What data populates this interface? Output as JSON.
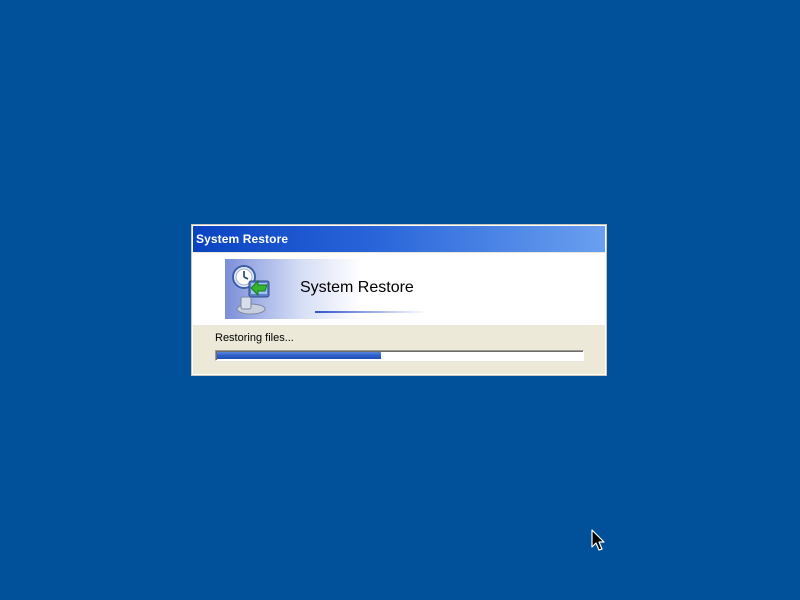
{
  "dialog": {
    "title": "System Restore",
    "banner_title": "System Restore",
    "status_text": "Restoring files...",
    "progress": 0.45
  },
  "icons": {
    "banner": "system-restore-icon",
    "pointer": "mouse-cursor-icon"
  },
  "colors": {
    "desktop": "#00519a",
    "title_bar_start": "#0a43c2",
    "title_bar_end": "#6aa0f0",
    "progress_fill": "#2f5fc9"
  }
}
